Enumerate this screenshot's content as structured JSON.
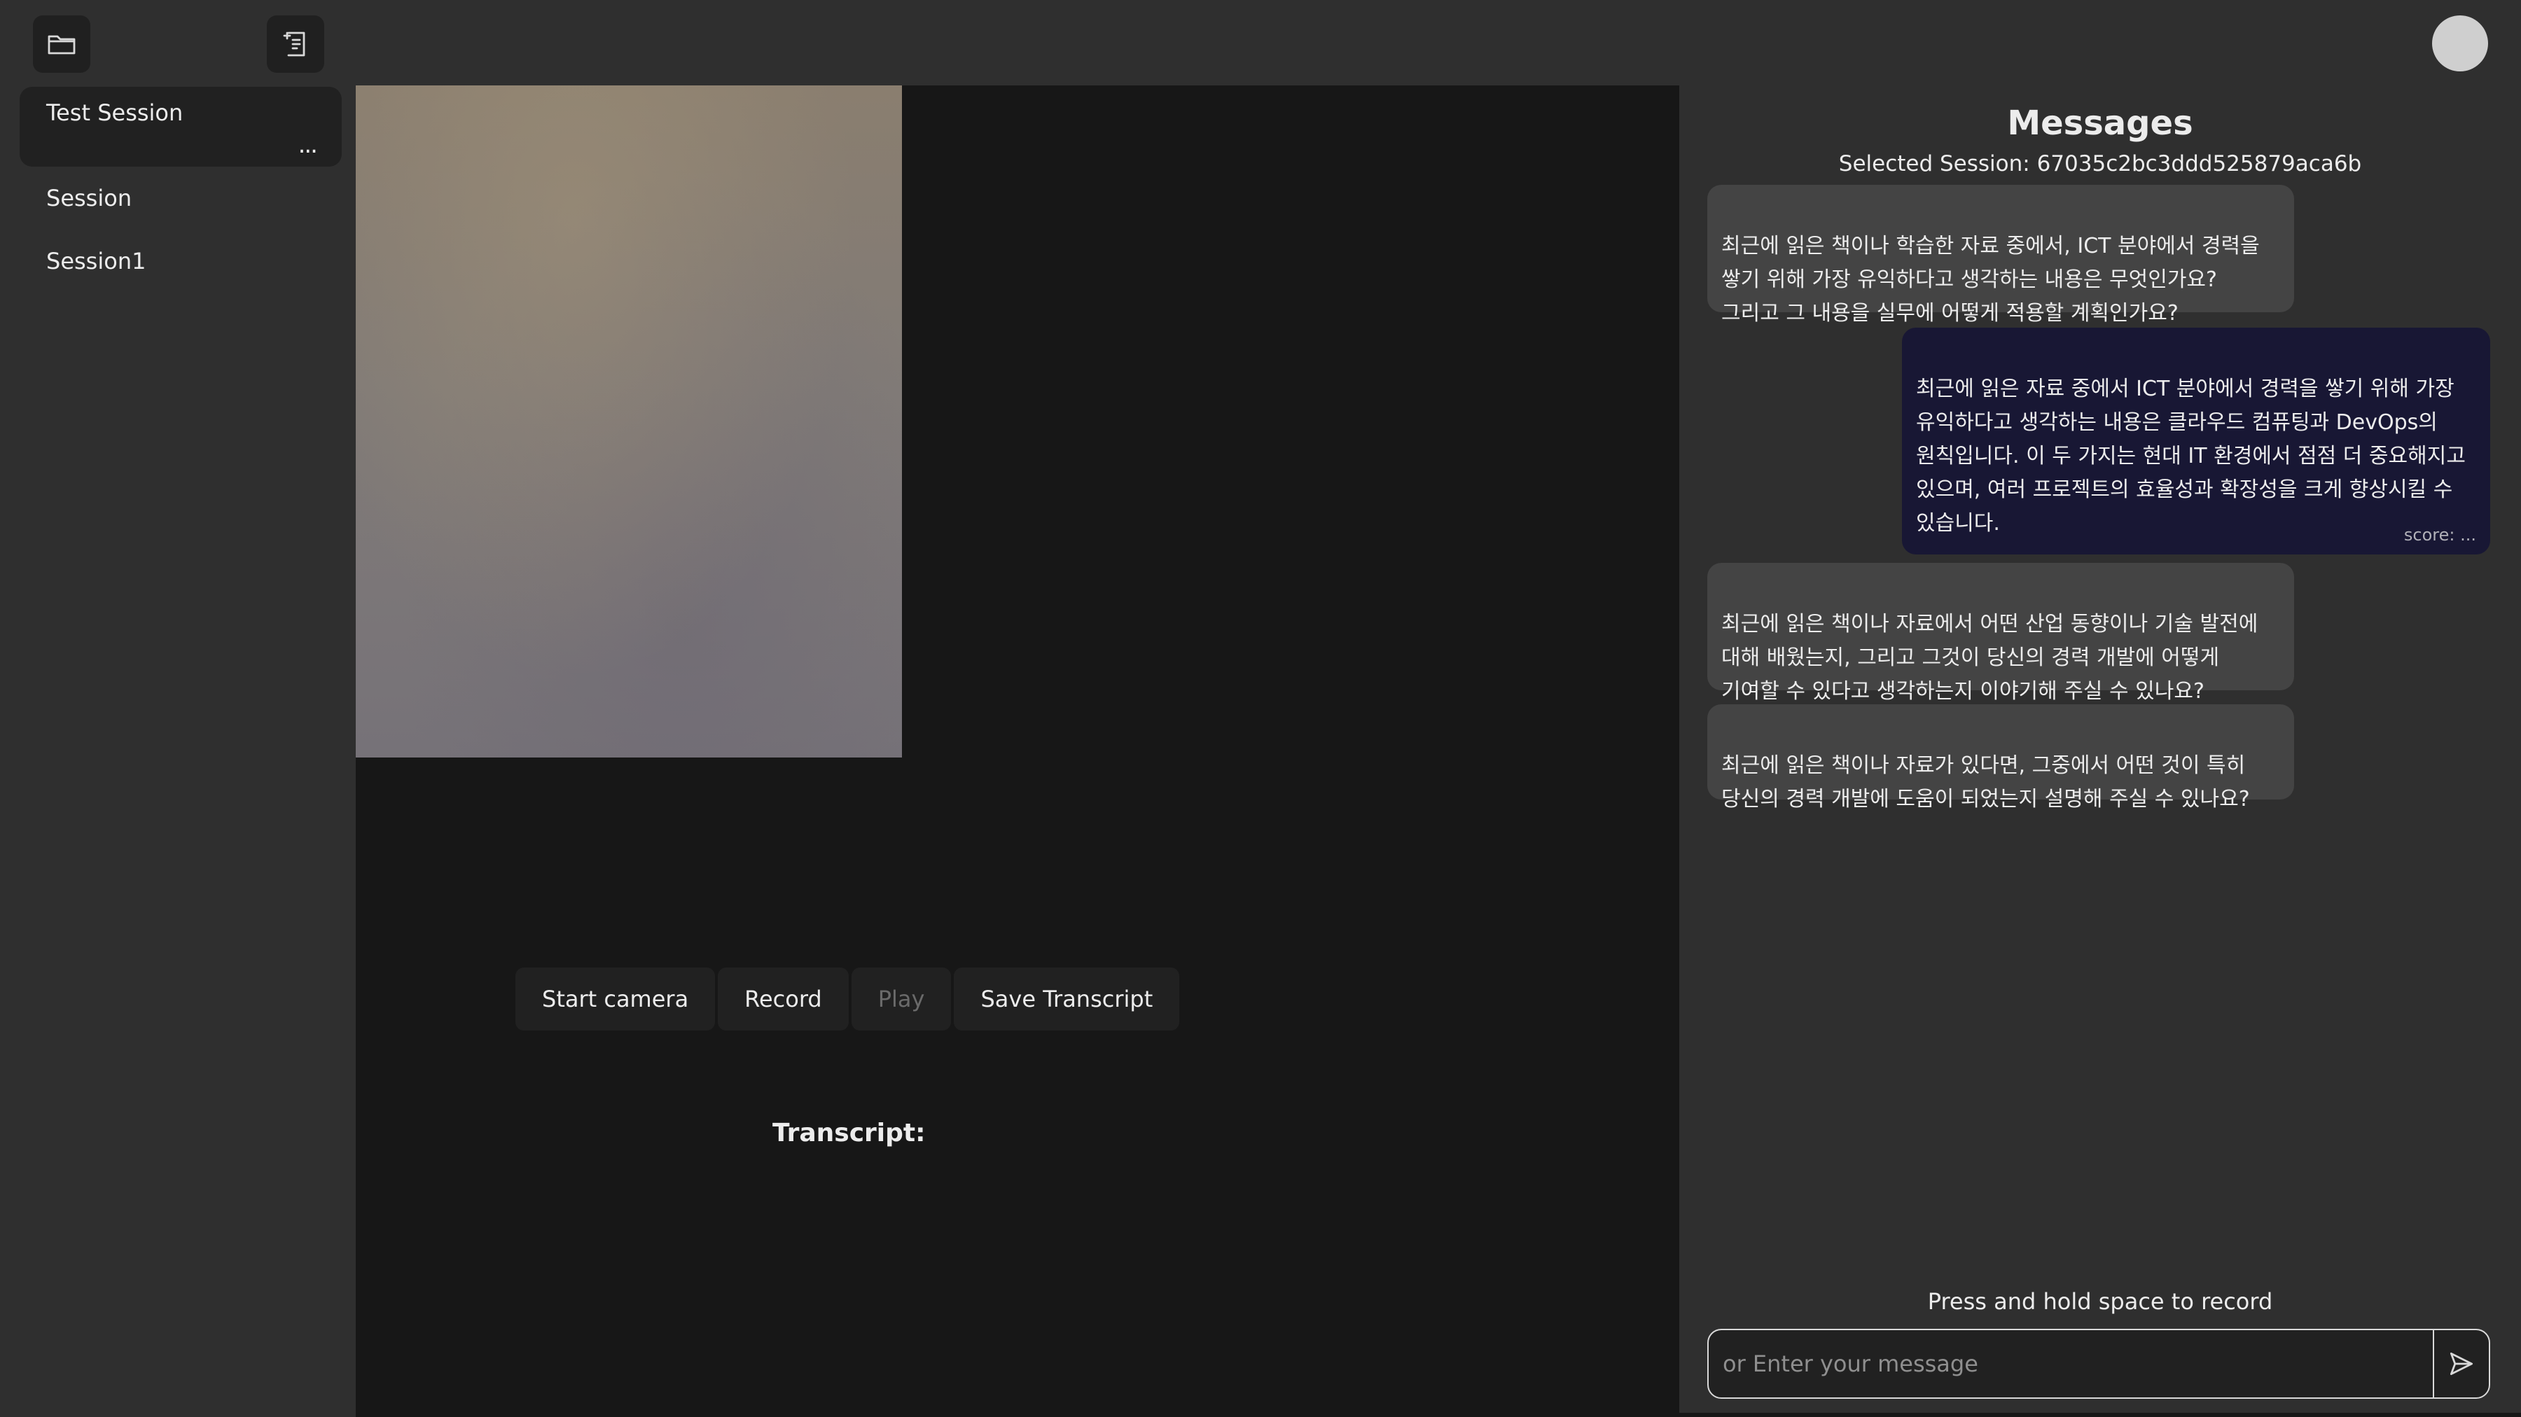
{
  "sidebar": {
    "open_folder_icon": "folder-icon",
    "new_session_icon": "new-note-icon",
    "sessions": [
      {
        "label": "Test Session",
        "active": true,
        "menu": "..."
      },
      {
        "label": "Session"
      },
      {
        "label": "Session1"
      }
    ]
  },
  "topbar": {
    "avatar_icon": "user-avatar"
  },
  "controls": {
    "start_camera": "Start camera",
    "record": "Record",
    "play": "Play",
    "save_transcript": "Save Transcript"
  },
  "transcript": {
    "label": "Transcript:"
  },
  "messages": {
    "title": "Messages",
    "selected_session": "Selected Session: 67035c2bc3ddd525879aca6b",
    "items": [
      {
        "role": "bot",
        "text": "최근에 읽은 책이나 학습한 자료 중에서, ICT 분야에서 경력을\n쌓기 위해 가장 유익하다고 생각하는 내용은 무엇인가요?\n그리고 그 내용을 실무에 어떻게 적용할 계획인가요?"
      },
      {
        "role": "user",
        "text": "최근에 읽은 자료 중에서 ICT 분야에서 경력을 쌓기 위해 가장\n유익하다고 생각하는 내용은 클라우드 컴퓨팅과 DevOps의\n원칙입니다. 이 두 가지는 현대 IT 환경에서 점점 더 중요해지고\n있으며, 여러 프로젝트의 효율성과 확장성을 크게 향상시킬 수\n있습니다.",
        "score": "score: ..."
      },
      {
        "role": "bot",
        "text": "최근에 읽은 책이나 자료에서 어떤 산업 동향이나 기술 발전에\n대해 배웠는지, 그리고 그것이 당신의 경력 개발에 어떻게\n기여할 수 있다고 생각하는지 이야기해 주실 수 있나요?"
      },
      {
        "role": "bot",
        "text": "최근에 읽은 책이나 자료가 있다면, 그중에서 어떤 것이 특히\n당신의 경력 개발에 도움이 되었는지 설명해 주실 수 있나요?"
      }
    ],
    "hint": "Press and hold space to record",
    "input_placeholder": "or Enter your message",
    "send_icon": "send-icon"
  }
}
